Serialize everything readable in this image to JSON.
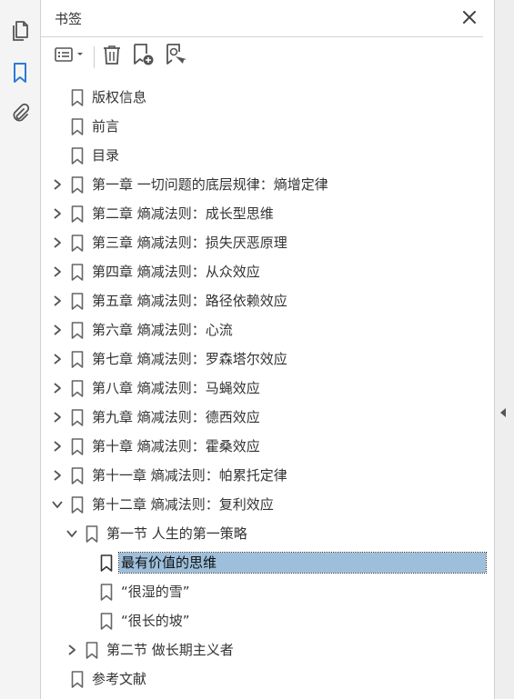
{
  "panel": {
    "title": "书签"
  },
  "toolbar": {
    "options_icon": "list-options-icon",
    "delete_icon": "trash-icon",
    "new_bookmark_icon": "bookmark-add-icon",
    "new_from_structure_icon": "bookmark-search-icon"
  },
  "left_rail": {
    "items": [
      "pages-icon",
      "bookmarks-icon",
      "attachments-icon"
    ],
    "active": "bookmarks-icon",
    "accent": "#2d7ad6"
  },
  "tree": {
    "selection_color": "#9dbfdb",
    "items": [
      {
        "label": "版权信息",
        "level": 0,
        "expander": "none"
      },
      {
        "label": "前言",
        "level": 0,
        "expander": "none"
      },
      {
        "label": "目录",
        "level": 0,
        "expander": "none"
      },
      {
        "label": "第一章 一切问题的底层规律：熵增定律",
        "level": 0,
        "expander": "collapsed"
      },
      {
        "label": "第二章 熵减法则：成长型思维",
        "level": 0,
        "expander": "collapsed"
      },
      {
        "label": "第三章 熵减法则：损失厌恶原理",
        "level": 0,
        "expander": "collapsed"
      },
      {
        "label": "第四章 熵减法则：从众效应",
        "level": 0,
        "expander": "collapsed"
      },
      {
        "label": "第五章 熵减法则：路径依赖效应",
        "level": 0,
        "expander": "collapsed"
      },
      {
        "label": "第六章 熵减法则：心流",
        "level": 0,
        "expander": "collapsed"
      },
      {
        "label": "第七章 熵减法则：罗森塔尔效应",
        "level": 0,
        "expander": "collapsed"
      },
      {
        "label": "第八章 熵减法则：马蝇效应",
        "level": 0,
        "expander": "collapsed"
      },
      {
        "label": "第九章 熵减法则：德西效应",
        "level": 0,
        "expander": "collapsed"
      },
      {
        "label": "第十章 熵减法则：霍桑效应",
        "level": 0,
        "expander": "collapsed"
      },
      {
        "label": "第十一章 熵减法则：帕累托定律",
        "level": 0,
        "expander": "collapsed"
      },
      {
        "label": "第十二章 熵减法则：复利效应",
        "level": 0,
        "expander": "expanded"
      },
      {
        "label": "第一节 人生的第一策略",
        "level": 1,
        "expander": "expanded"
      },
      {
        "label": "最有价值的思维",
        "level": 2,
        "expander": "none",
        "selected": true
      },
      {
        "label": "“很湿的雪”",
        "level": 2,
        "expander": "none"
      },
      {
        "label": "“很长的坡”",
        "level": 2,
        "expander": "none"
      },
      {
        "label": "第二节 做长期主义者",
        "level": 1,
        "expander": "collapsed"
      },
      {
        "label": "参考文献",
        "level": 0,
        "expander": "none"
      }
    ]
  }
}
